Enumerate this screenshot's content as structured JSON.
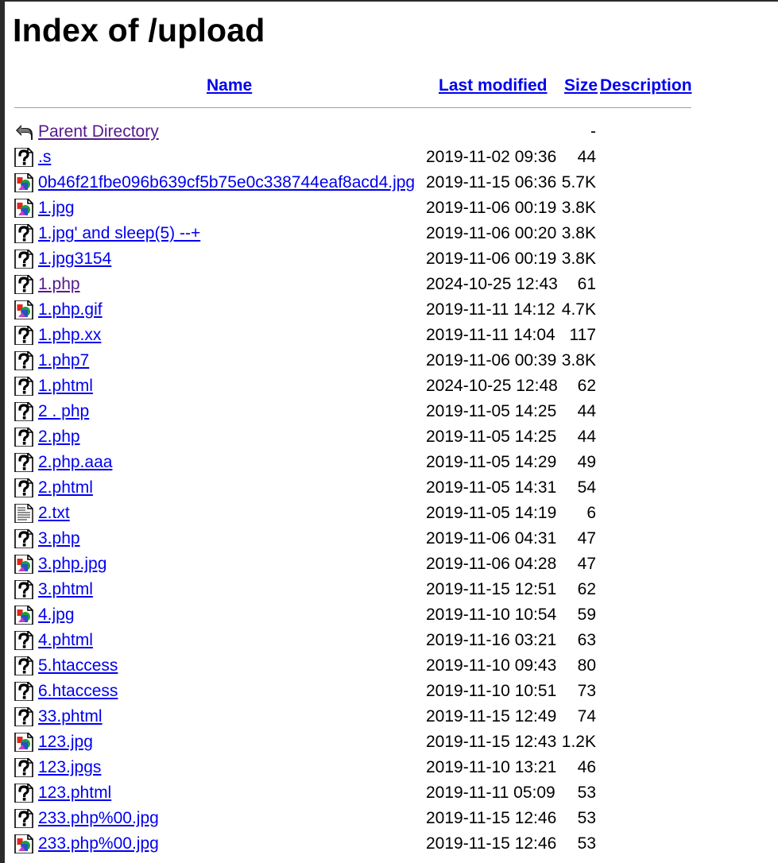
{
  "title": "Index of /upload",
  "columns": {
    "name": "Name",
    "last_modified": "Last modified",
    "size": "Size",
    "description": "Description"
  },
  "parent": {
    "name": "Parent Directory",
    "size": "-",
    "icon": "back-icon"
  },
  "rows": [
    {
      "name": ".s",
      "date": "2019-11-02 09:36",
      "size": "44",
      "icon": "unknown-icon"
    },
    {
      "name": "0b46f21fbe096b639cf5b75e0c338744eaf8acd4.jpg",
      "date": "2019-11-15 06:36",
      "size": "5.7K",
      "icon": "image-icon"
    },
    {
      "name": "1.jpg",
      "date": "2019-11-06 00:19",
      "size": "3.8K",
      "icon": "image-icon"
    },
    {
      "name": "1.jpg' and sleep(5) --+",
      "date": "2019-11-06 00:20",
      "size": "3.8K",
      "icon": "unknown-icon"
    },
    {
      "name": "1.jpg3154",
      "date": "2019-11-06 00:19",
      "size": "3.8K",
      "icon": "unknown-icon"
    },
    {
      "name": "1.php",
      "date": "2024-10-25 12:43",
      "size": "61",
      "icon": "unknown-icon",
      "visited": true
    },
    {
      "name": "1.php.gif",
      "date": "2019-11-11 14:12",
      "size": "4.7K",
      "icon": "image-icon"
    },
    {
      "name": "1.php.xx",
      "date": "2019-11-11 14:04",
      "size": "117",
      "icon": "unknown-icon"
    },
    {
      "name": "1.php7",
      "date": "2019-11-06 00:39",
      "size": "3.8K",
      "icon": "unknown-icon"
    },
    {
      "name": "1.phtml",
      "date": "2024-10-25 12:48",
      "size": "62",
      "icon": "unknown-icon"
    },
    {
      "name": "2 . php",
      "date": "2019-11-05 14:25",
      "size": "44",
      "icon": "unknown-icon"
    },
    {
      "name": "2.php",
      "date": "2019-11-05 14:25",
      "size": "44",
      "icon": "unknown-icon"
    },
    {
      "name": "2.php.aaa",
      "date": "2019-11-05 14:29",
      "size": "49",
      "icon": "unknown-icon"
    },
    {
      "name": "2.phtml",
      "date": "2019-11-05 14:31",
      "size": "54",
      "icon": "unknown-icon"
    },
    {
      "name": "2.txt",
      "date": "2019-11-05 14:19",
      "size": "6",
      "icon": "text-icon"
    },
    {
      "name": "3.php",
      "date": "2019-11-06 04:31",
      "size": "47",
      "icon": "unknown-icon"
    },
    {
      "name": "3.php.jpg",
      "date": "2019-11-06 04:28",
      "size": "47",
      "icon": "image-icon"
    },
    {
      "name": "3.phtml",
      "date": "2019-11-15 12:51",
      "size": "62",
      "icon": "unknown-icon"
    },
    {
      "name": "4.jpg",
      "date": "2019-11-10 10:54",
      "size": "59",
      "icon": "image-icon"
    },
    {
      "name": "4.phtml",
      "date": "2019-11-16 03:21",
      "size": "63",
      "icon": "unknown-icon"
    },
    {
      "name": "5.htaccess",
      "date": "2019-11-10 09:43",
      "size": "80",
      "icon": "unknown-icon"
    },
    {
      "name": "6.htaccess",
      "date": "2019-11-10 10:51",
      "size": "73",
      "icon": "unknown-icon"
    },
    {
      "name": "33.phtml",
      "date": "2019-11-15 12:49",
      "size": "74",
      "icon": "unknown-icon"
    },
    {
      "name": "123.jpg",
      "date": "2019-11-15 12:43",
      "size": "1.2K",
      "icon": "image-icon"
    },
    {
      "name": "123.jpgs",
      "date": "2019-11-10 13:21",
      "size": "46",
      "icon": "unknown-icon"
    },
    {
      "name": "123.phtml",
      "date": "2019-11-11 05:09",
      "size": "53",
      "icon": "unknown-icon"
    },
    {
      "name": "233.php%00.jpg",
      "date": "2019-11-15 12:46",
      "size": "53",
      "icon": "unknown-icon"
    },
    {
      "name": "233.php%00.jpg",
      "date": "2019-11-15 12:46",
      "size": "53",
      "icon": "image-icon"
    }
  ]
}
